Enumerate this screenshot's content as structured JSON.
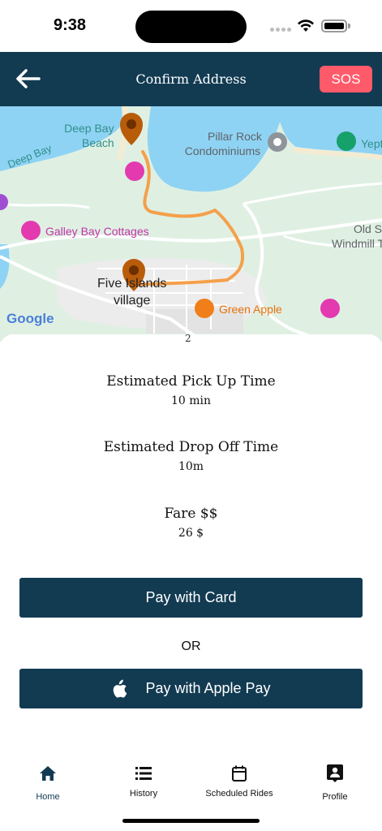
{
  "status_bar": {
    "time": "9:38"
  },
  "header": {
    "title": "Confirm Address",
    "sos_label": "SOS"
  },
  "map": {
    "labels": {
      "deep_bay_beach": "Deep Bay Beach",
      "deep_bay_beach_line1": "Deep Bay",
      "deep_bay_beach_line2": "Beach",
      "deep_bay": "Deep Bay",
      "pillar_rock_line1": "Pillar Rock",
      "pillar_rock_line2": "Condominiums",
      "yepton": "Yept",
      "galley_bay": "Galley Bay Cottages",
      "old_windmill_line1": "Old S",
      "old_windmill_line2": "Windmill T",
      "five_islands_line1": "Five Islands",
      "five_islands_line2": "village",
      "green_apple": "Green Apple",
      "google": "Google"
    }
  },
  "trip": {
    "clipped_value": "2",
    "pickup_title": "Estimated Pick Up Time",
    "pickup_value": "10 min",
    "dropoff_title": "Estimated Drop Off Time",
    "dropoff_value": "10m",
    "fare_title": "Fare $$",
    "fare_value": "26 $"
  },
  "payment": {
    "card_label": "Pay with Card",
    "or_label": "OR",
    "apple_label": "Pay with Apple Pay"
  },
  "nav": {
    "home": "Home",
    "history": "History",
    "scheduled": "Scheduled Rides",
    "profile": "Profile"
  },
  "colors": {
    "primary": "#123b52",
    "sos": "#ff5a6a",
    "route": "#f4a04a",
    "pin": "#b85c0a"
  }
}
